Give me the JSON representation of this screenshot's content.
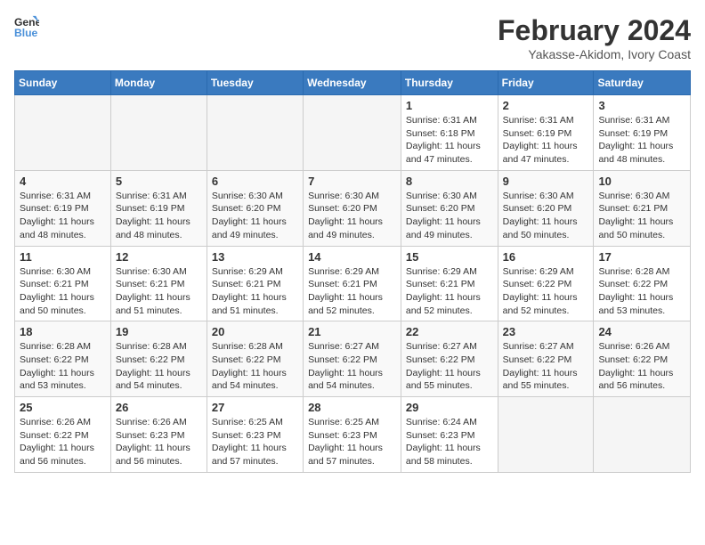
{
  "header": {
    "logo_line1": "General",
    "logo_line2": "Blue",
    "month_year": "February 2024",
    "location": "Yakasse-Akidom, Ivory Coast"
  },
  "weekdays": [
    "Sunday",
    "Monday",
    "Tuesday",
    "Wednesday",
    "Thursday",
    "Friday",
    "Saturday"
  ],
  "weeks": [
    [
      {
        "day": "",
        "info": ""
      },
      {
        "day": "",
        "info": ""
      },
      {
        "day": "",
        "info": ""
      },
      {
        "day": "",
        "info": ""
      },
      {
        "day": "1",
        "info": "Sunrise: 6:31 AM\nSunset: 6:18 PM\nDaylight: 11 hours and 47 minutes."
      },
      {
        "day": "2",
        "info": "Sunrise: 6:31 AM\nSunset: 6:19 PM\nDaylight: 11 hours and 47 minutes."
      },
      {
        "day": "3",
        "info": "Sunrise: 6:31 AM\nSunset: 6:19 PM\nDaylight: 11 hours and 48 minutes."
      }
    ],
    [
      {
        "day": "4",
        "info": "Sunrise: 6:31 AM\nSunset: 6:19 PM\nDaylight: 11 hours and 48 minutes."
      },
      {
        "day": "5",
        "info": "Sunrise: 6:31 AM\nSunset: 6:19 PM\nDaylight: 11 hours and 48 minutes."
      },
      {
        "day": "6",
        "info": "Sunrise: 6:30 AM\nSunset: 6:20 PM\nDaylight: 11 hours and 49 minutes."
      },
      {
        "day": "7",
        "info": "Sunrise: 6:30 AM\nSunset: 6:20 PM\nDaylight: 11 hours and 49 minutes."
      },
      {
        "day": "8",
        "info": "Sunrise: 6:30 AM\nSunset: 6:20 PM\nDaylight: 11 hours and 49 minutes."
      },
      {
        "day": "9",
        "info": "Sunrise: 6:30 AM\nSunset: 6:20 PM\nDaylight: 11 hours and 50 minutes."
      },
      {
        "day": "10",
        "info": "Sunrise: 6:30 AM\nSunset: 6:21 PM\nDaylight: 11 hours and 50 minutes."
      }
    ],
    [
      {
        "day": "11",
        "info": "Sunrise: 6:30 AM\nSunset: 6:21 PM\nDaylight: 11 hours and 50 minutes."
      },
      {
        "day": "12",
        "info": "Sunrise: 6:30 AM\nSunset: 6:21 PM\nDaylight: 11 hours and 51 minutes."
      },
      {
        "day": "13",
        "info": "Sunrise: 6:29 AM\nSunset: 6:21 PM\nDaylight: 11 hours and 51 minutes."
      },
      {
        "day": "14",
        "info": "Sunrise: 6:29 AM\nSunset: 6:21 PM\nDaylight: 11 hours and 52 minutes."
      },
      {
        "day": "15",
        "info": "Sunrise: 6:29 AM\nSunset: 6:21 PM\nDaylight: 11 hours and 52 minutes."
      },
      {
        "day": "16",
        "info": "Sunrise: 6:29 AM\nSunset: 6:22 PM\nDaylight: 11 hours and 52 minutes."
      },
      {
        "day": "17",
        "info": "Sunrise: 6:28 AM\nSunset: 6:22 PM\nDaylight: 11 hours and 53 minutes."
      }
    ],
    [
      {
        "day": "18",
        "info": "Sunrise: 6:28 AM\nSunset: 6:22 PM\nDaylight: 11 hours and 53 minutes."
      },
      {
        "day": "19",
        "info": "Sunrise: 6:28 AM\nSunset: 6:22 PM\nDaylight: 11 hours and 54 minutes."
      },
      {
        "day": "20",
        "info": "Sunrise: 6:28 AM\nSunset: 6:22 PM\nDaylight: 11 hours and 54 minutes."
      },
      {
        "day": "21",
        "info": "Sunrise: 6:27 AM\nSunset: 6:22 PM\nDaylight: 11 hours and 54 minutes."
      },
      {
        "day": "22",
        "info": "Sunrise: 6:27 AM\nSunset: 6:22 PM\nDaylight: 11 hours and 55 minutes."
      },
      {
        "day": "23",
        "info": "Sunrise: 6:27 AM\nSunset: 6:22 PM\nDaylight: 11 hours and 55 minutes."
      },
      {
        "day": "24",
        "info": "Sunrise: 6:26 AM\nSunset: 6:22 PM\nDaylight: 11 hours and 56 minutes."
      }
    ],
    [
      {
        "day": "25",
        "info": "Sunrise: 6:26 AM\nSunset: 6:22 PM\nDaylight: 11 hours and 56 minutes."
      },
      {
        "day": "26",
        "info": "Sunrise: 6:26 AM\nSunset: 6:23 PM\nDaylight: 11 hours and 56 minutes."
      },
      {
        "day": "27",
        "info": "Sunrise: 6:25 AM\nSunset: 6:23 PM\nDaylight: 11 hours and 57 minutes."
      },
      {
        "day": "28",
        "info": "Sunrise: 6:25 AM\nSunset: 6:23 PM\nDaylight: 11 hours and 57 minutes."
      },
      {
        "day": "29",
        "info": "Sunrise: 6:24 AM\nSunset: 6:23 PM\nDaylight: 11 hours and 58 minutes."
      },
      {
        "day": "",
        "info": ""
      },
      {
        "day": "",
        "info": ""
      }
    ]
  ]
}
